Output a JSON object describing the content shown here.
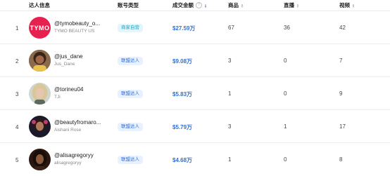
{
  "headers": {
    "creator": "达人信息",
    "account_type": "账号类型",
    "sales": "成交金额",
    "goods": "商品",
    "live": "直播",
    "video": "视频"
  },
  "rows": [
    {
      "index": "1",
      "handle": "@tymobeauty_o...",
      "name": "TYMO BEAUTY US",
      "type": "商家自营",
      "type_style": "cyan",
      "sales": "$27.59万",
      "goods": "67",
      "live": "36",
      "video": "42",
      "avatar_label": "TYMO"
    },
    {
      "index": "2",
      "handle": "@jus_dane",
      "name": "Jus_Dane",
      "type": "联盟达人",
      "type_style": "blue",
      "sales": "$9.08万",
      "goods": "3",
      "live": "0",
      "video": "7"
    },
    {
      "index": "3",
      "handle": "@torineu04",
      "name": "TJi",
      "type": "联盟达人",
      "type_style": "blue",
      "sales": "$5.83万",
      "goods": "1",
      "live": "0",
      "video": "9"
    },
    {
      "index": "4",
      "handle": "@beautyfromaro...",
      "name": "Aishani Rose",
      "type": "联盟达人",
      "type_style": "blue",
      "sales": "$5.79万",
      "goods": "3",
      "live": "1",
      "video": "17"
    },
    {
      "index": "5",
      "handle": "@alisagregoryy",
      "name": "alisagregoryy",
      "type": "联盟达人",
      "type_style": "blue",
      "sales": "$4.68万",
      "goods": "1",
      "live": "0",
      "video": "8"
    }
  ],
  "colors": {
    "accent": "#2f6fd8",
    "tymo_logo": "#e8204f"
  }
}
